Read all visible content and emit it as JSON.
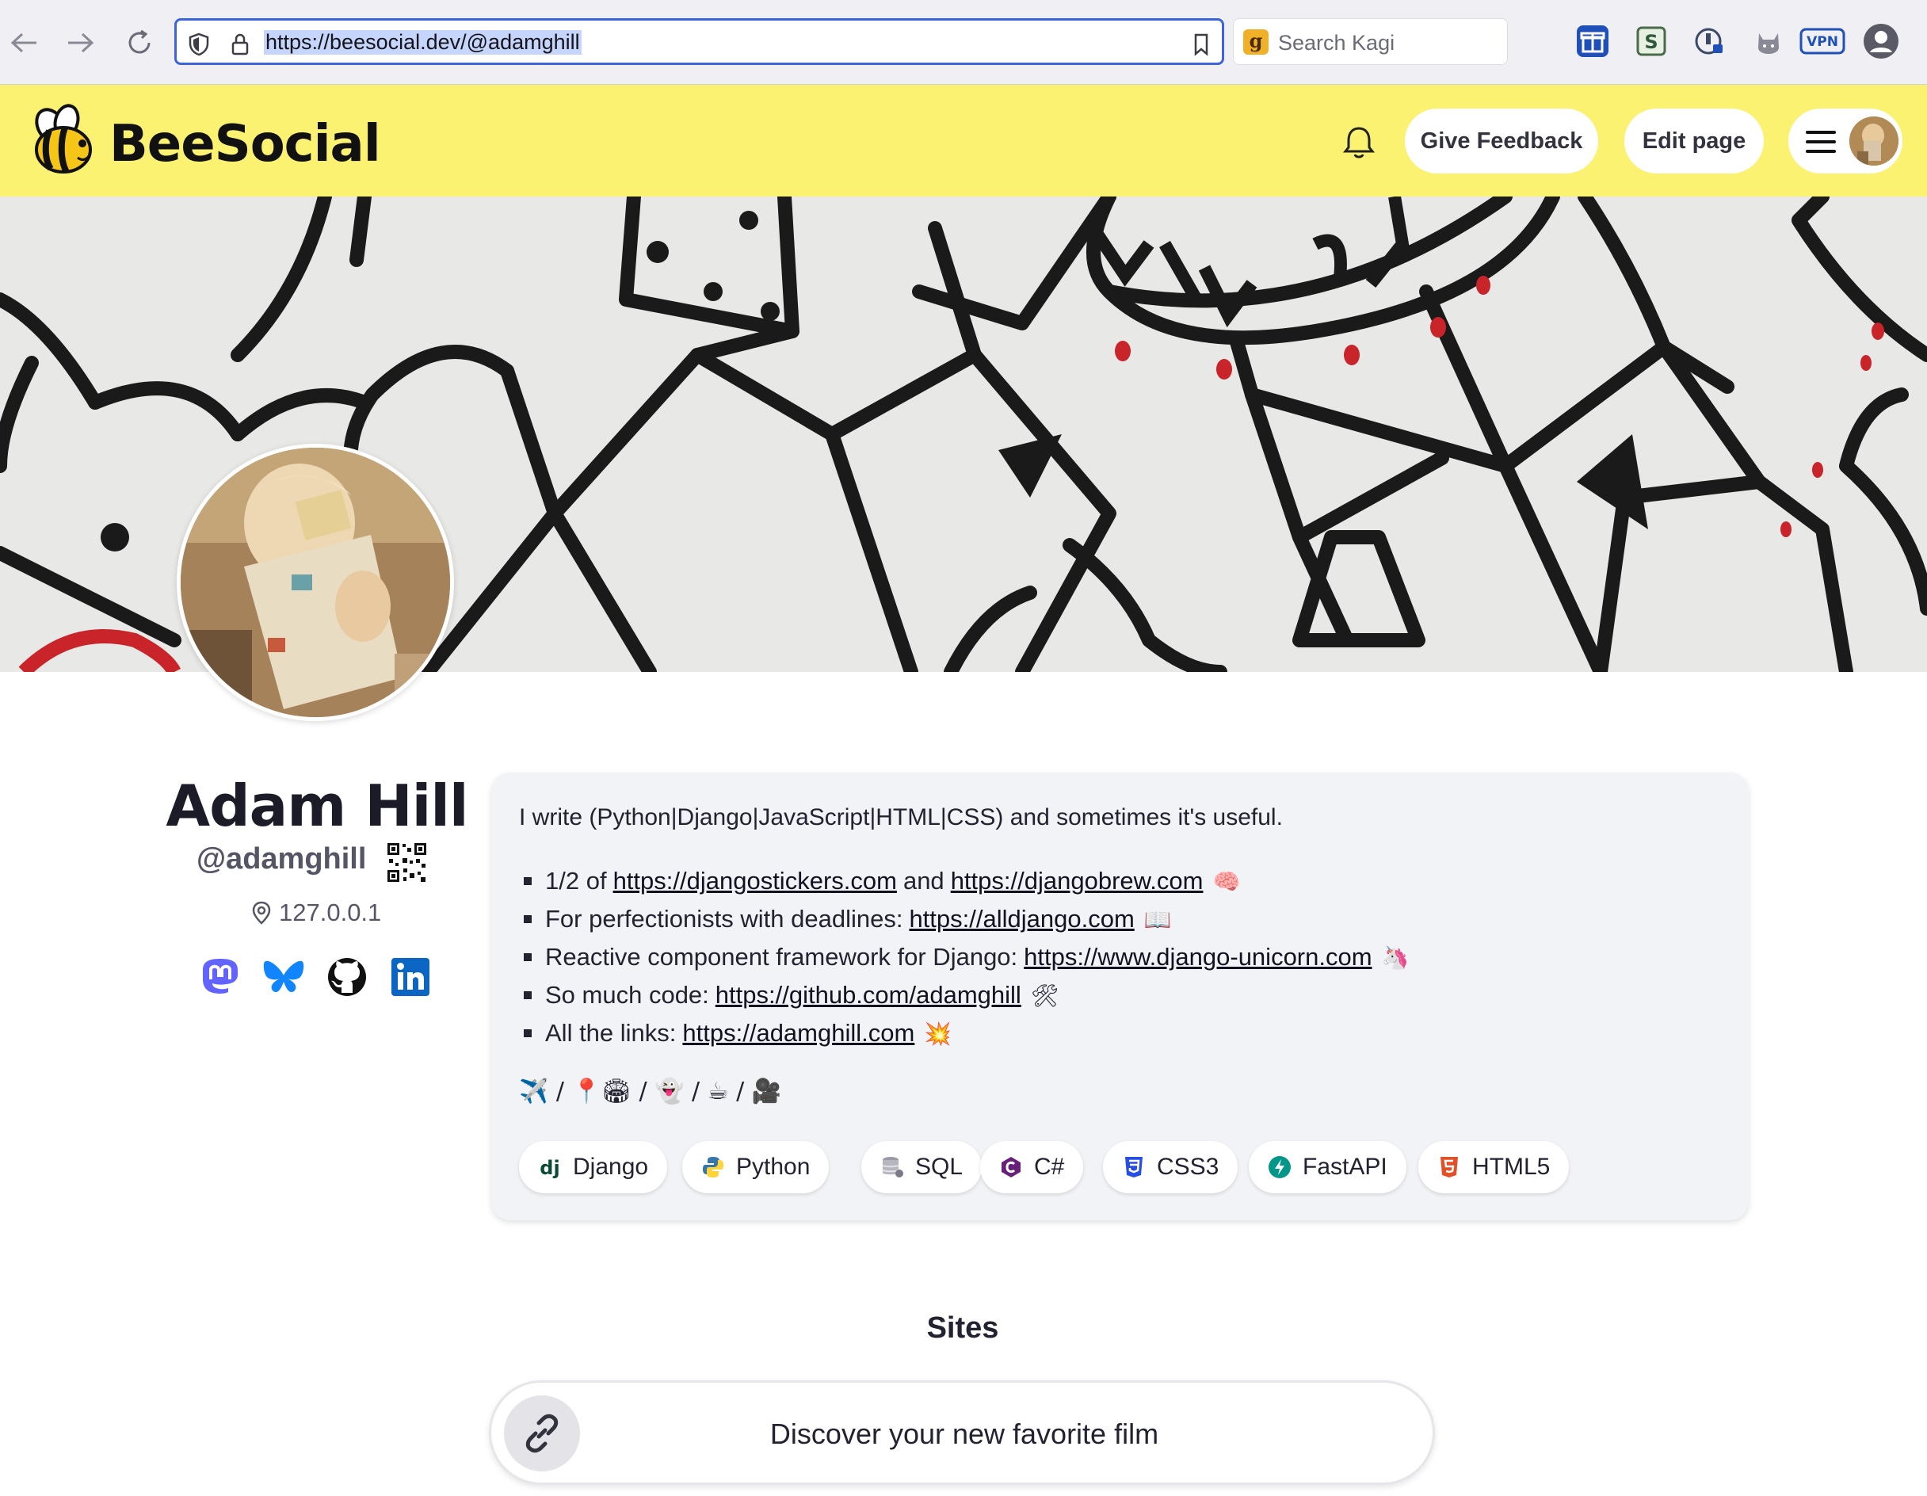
{
  "browser": {
    "url": "https://beesocial.dev/@adamghill",
    "search_placeholder": "Search Kagi",
    "search_logo": "g",
    "vpn_label": "VPN"
  },
  "header": {
    "logo_text": "BeeSocial",
    "give_feedback": "Give Feedback",
    "edit_page": "Edit page"
  },
  "profile": {
    "name": "Adam Hill",
    "handle": "@adamghill",
    "location": "127.0.0.1",
    "socials": [
      "mastodon-icon",
      "bluesky-icon",
      "github-icon",
      "linkedin-icon"
    ]
  },
  "bio": {
    "intro": "I write (Python|Django|JavaScript|HTML|CSS) and sometimes it's useful.",
    "items": [
      {
        "prefix": "1/2 of",
        "link1": "https://djangostickers.com",
        "mid": "and",
        "link2": "https://djangobrew.com",
        "emoji": "🧠"
      },
      {
        "prefix": "For perfectionists with deadlines:",
        "link1": "https://alldjango.com",
        "emoji": "📖"
      },
      {
        "prefix": "Reactive component framework for Django:",
        "link1": "https://www.django-unicorn.com",
        "emoji": "🦄"
      },
      {
        "prefix": "So much code:",
        "link1": "https://github.com/adamghill",
        "emoji": "🛠"
      },
      {
        "prefix": "All the links:",
        "link1": "https://adamghill.com",
        "emoji": "💥"
      }
    ],
    "emoji_line": "✈️ / 📍🏟 / 👻 / ☕ / 🎥",
    "tags": [
      "Django",
      "Python",
      "SQL",
      "C#",
      "CSS3",
      "FastAPI",
      "HTML5"
    ]
  },
  "sites": {
    "title": "Sites",
    "links": [
      {
        "label": "Discover your new favorite film"
      }
    ]
  },
  "colors": {
    "header_bg": "#fbf272",
    "url_border": "#3d63dd",
    "card_bg": "#f2f3f6"
  }
}
